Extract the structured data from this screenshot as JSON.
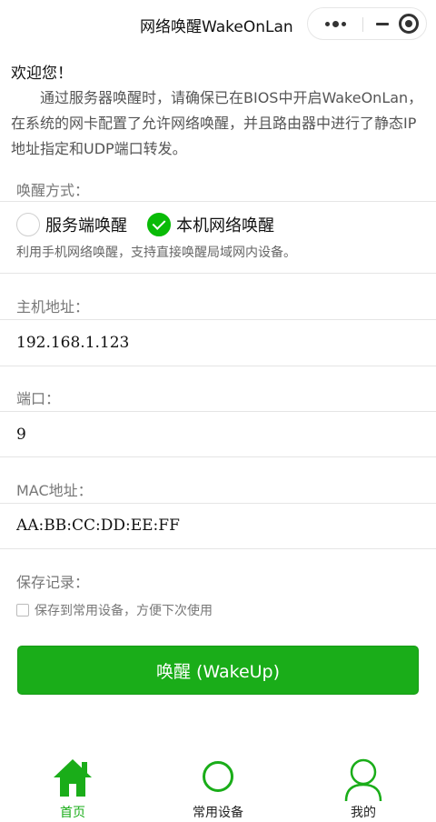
{
  "nav": {
    "title": "网络唤醒WakeOnLan"
  },
  "intro": {
    "welcome": "欢迎您！",
    "text": "通过服务器唤醒时，请确保已在BIOS中开启WakeOnLan，在系统的网卡配置了允许网络唤醒，并且路由器中进行了静态IP地址指定和UDP端口转发。"
  },
  "wake_mode": {
    "label": "唤醒方式：",
    "options": [
      {
        "label": "服务端唤醒",
        "checked": false
      },
      {
        "label": "本机网络唤醒",
        "checked": true
      }
    ],
    "hint": "利用手机网络唤醒，支持直接唤醒局域网内设备。"
  },
  "fields": {
    "host": {
      "label": "主机地址：",
      "value": "192.168.1.123"
    },
    "port": {
      "label": "端口：",
      "value": "9"
    },
    "mac": {
      "label": "MAC地址：",
      "value": "AA:BB:CC:DD:EE:FF"
    }
  },
  "save": {
    "label": "保存记录：",
    "checkbox_label": "保存到常用设备，方便下次使用",
    "checked": false
  },
  "wake_button": {
    "label": "唤醒 (WakeUp)"
  },
  "tabbar": {
    "items": [
      {
        "label": "首页",
        "icon": "home-icon",
        "active": true
      },
      {
        "label": "常用设备",
        "icon": "circle-icon",
        "active": false
      },
      {
        "label": "我的",
        "icon": "user-icon",
        "active": false
      }
    ]
  },
  "colors": {
    "accent": "#1aad19",
    "radio_checked": "#09bb07"
  }
}
